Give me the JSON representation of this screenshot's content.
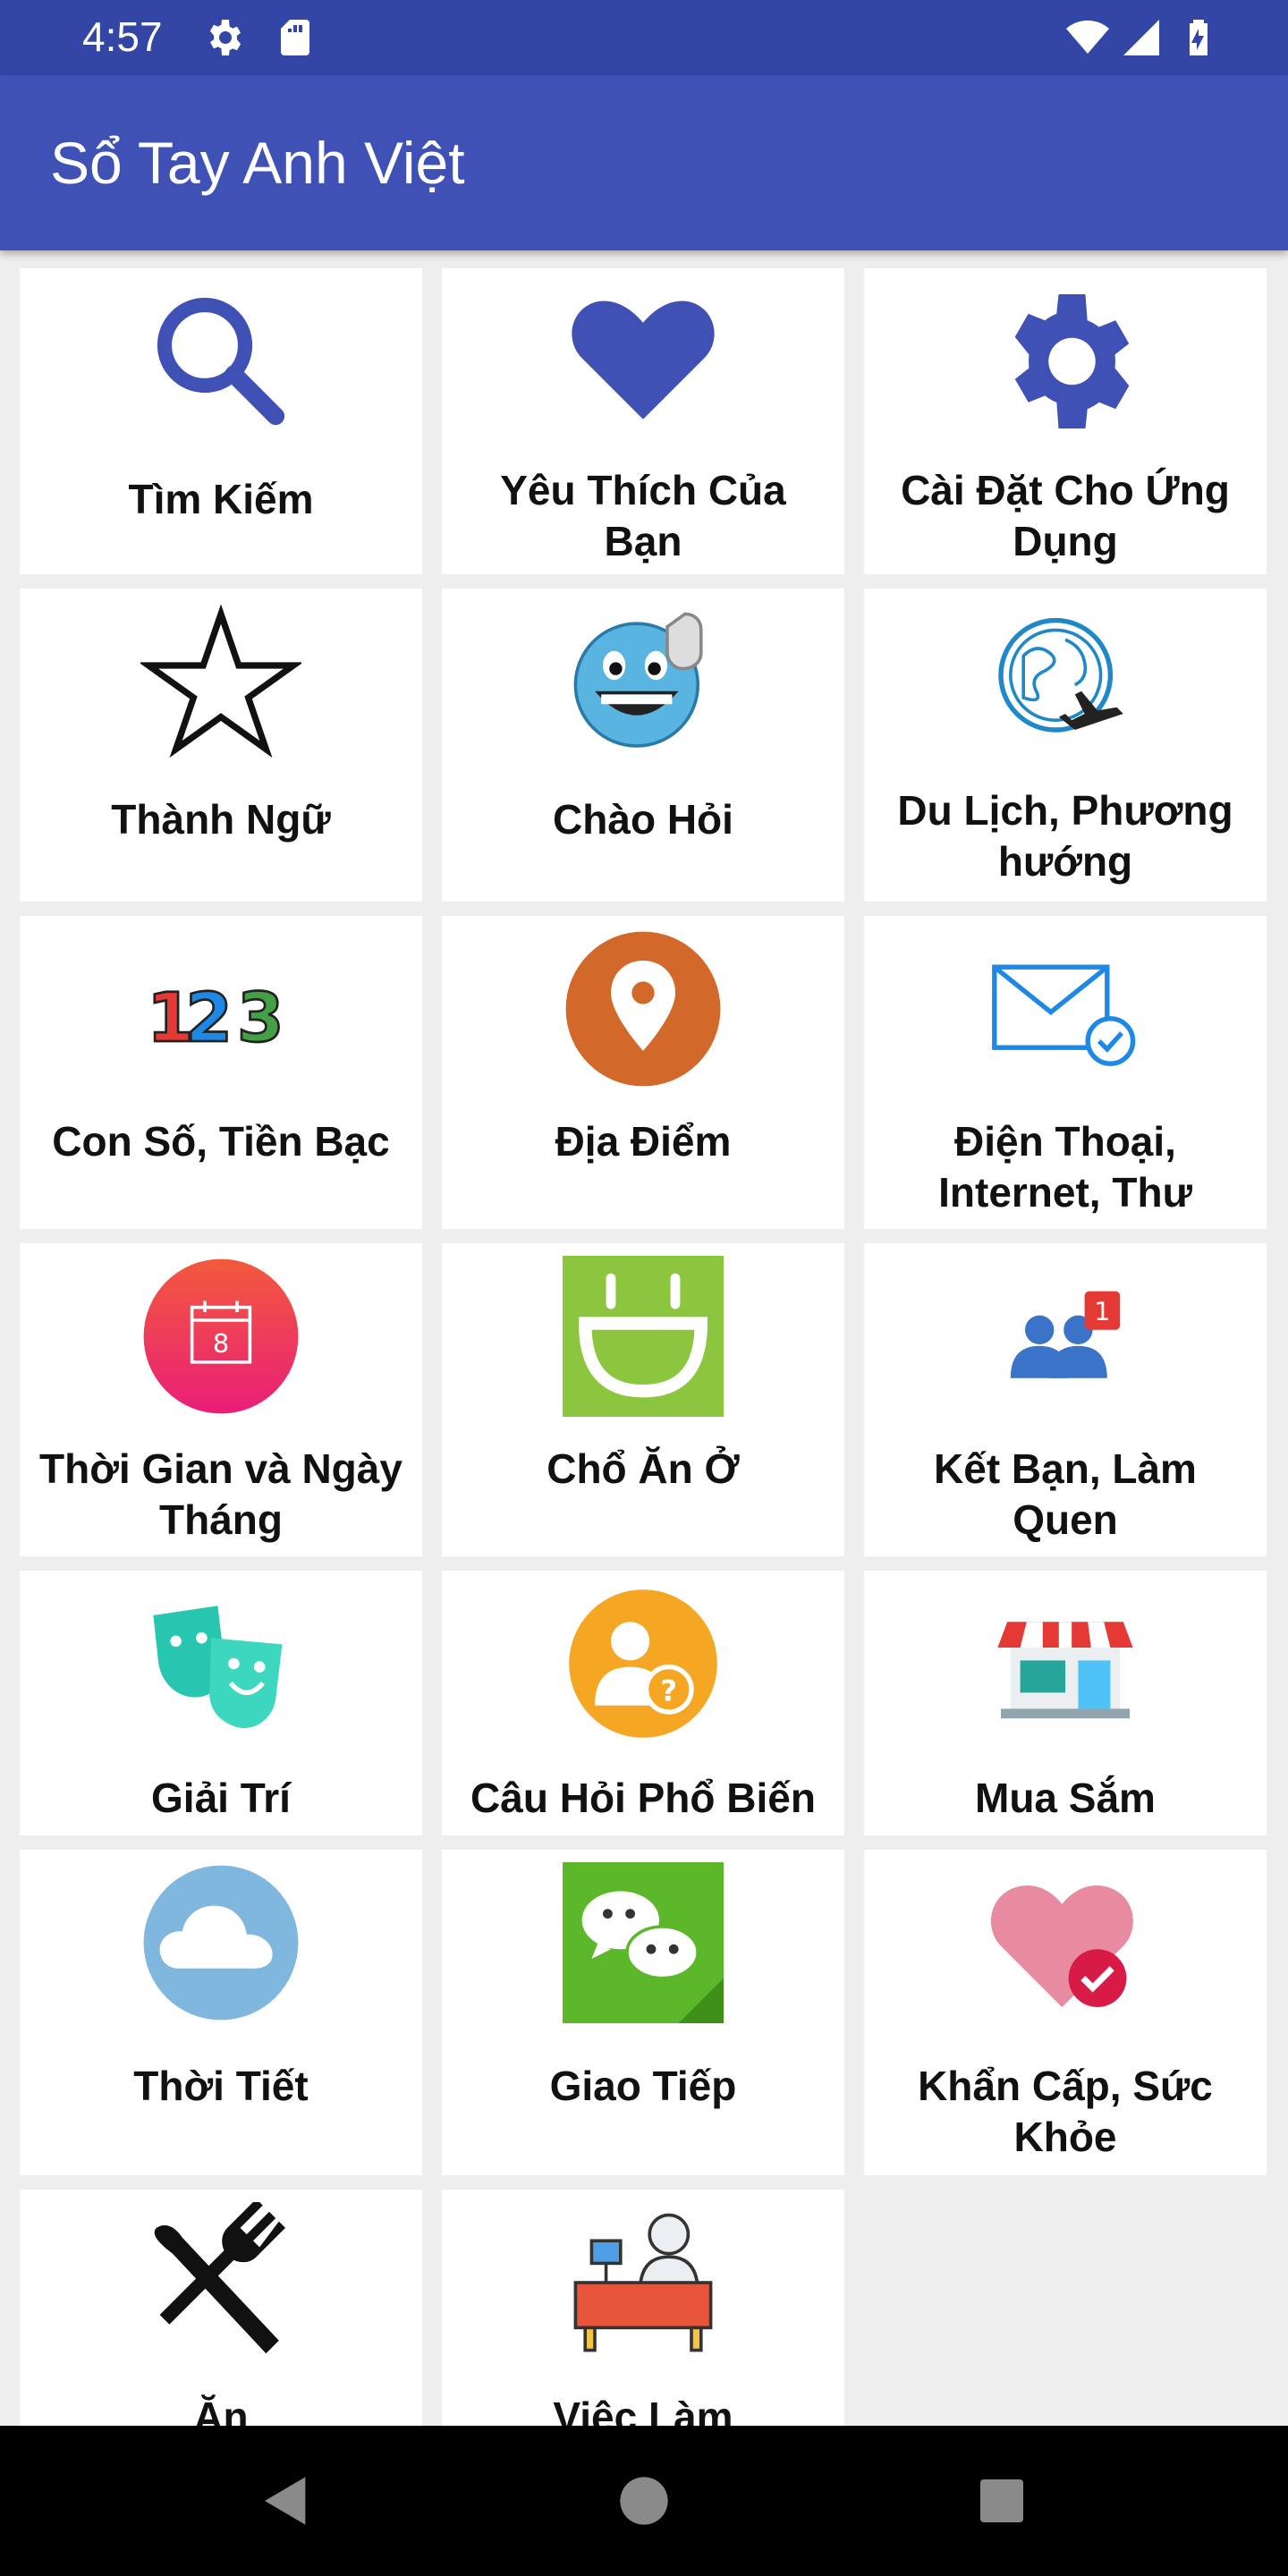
{
  "status_bar": {
    "time": "4:57",
    "icons": [
      "settings-icon",
      "sd-card-icon",
      "wifi-icon",
      "signal-icon",
      "battery-charging-icon"
    ]
  },
  "app_bar": {
    "title": "Sổ Tay Anh Việt"
  },
  "colors": {
    "app_bar": "#3f51b5",
    "status_bar": "#3346a6",
    "accent": "#3f51b5"
  },
  "categories": [
    {
      "label": "Tìm Kiếm",
      "icon": "search-icon"
    },
    {
      "label": "Yêu Thích Của Bạn",
      "icon": "heart-icon"
    },
    {
      "label": "Cài Đặt Cho Ứng Dụng",
      "icon": "gear-icon"
    },
    {
      "label": "Thành Ngữ",
      "icon": "star-icon"
    },
    {
      "label": "Chào Hỏi",
      "icon": "waving-smiley-icon"
    },
    {
      "label": "Du Lịch, Phương hướng",
      "icon": "globe-plane-icon"
    },
    {
      "label": "Con Số, Tiền Bạc",
      "icon": "numbers-123-icon"
    },
    {
      "label": "Địa Điểm",
      "icon": "location-pin-icon"
    },
    {
      "label": "Điện Thoại, Internet, Thư",
      "icon": "mail-check-icon"
    },
    {
      "label": "Thời Gian và Ngày Tháng",
      "icon": "calendar-icon"
    },
    {
      "label": "Chổ Ăn Ở",
      "icon": "smile-square-icon"
    },
    {
      "label": "Kết Bạn, Làm Quen",
      "icon": "friends-notification-icon"
    },
    {
      "label": "Giải Trí",
      "icon": "theater-masks-icon"
    },
    {
      "label": "Câu Hỏi Phổ Biến",
      "icon": "user-question-icon"
    },
    {
      "label": "Mua Sắm",
      "icon": "shop-icon"
    },
    {
      "label": "Thời Tiết",
      "icon": "cloud-icon"
    },
    {
      "label": "Giao Tiếp",
      "icon": "chat-bubbles-icon"
    },
    {
      "label": "Khẩn Cấp, Sức Khỏe",
      "icon": "heart-check-icon"
    },
    {
      "label": "Ăn",
      "icon": "fork-knife-icon"
    },
    {
      "label": "Việc Làm",
      "icon": "desk-worker-icon"
    }
  ],
  "calendar_day": "8",
  "friends_badge": "1",
  "nav_bar": {
    "buttons": [
      "back-button",
      "home-button",
      "recents-button"
    ]
  }
}
